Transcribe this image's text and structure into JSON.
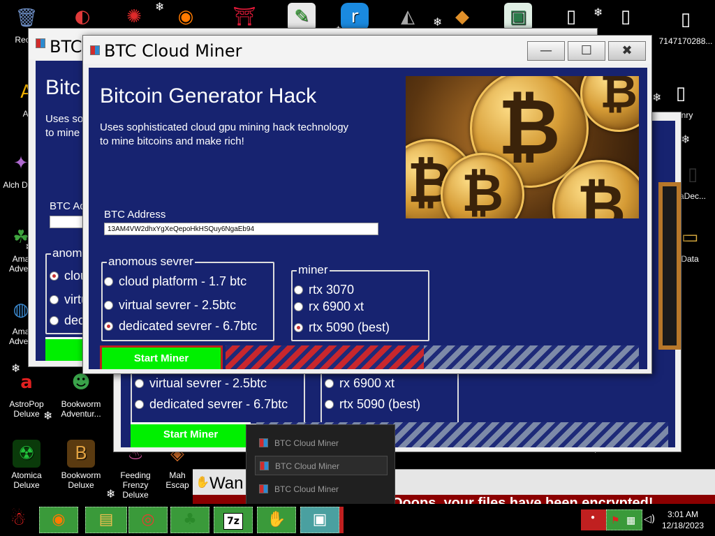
{
  "desktop": {
    "icons": [
      {
        "label": "Recyc",
        "icon": "recycle-bin-icon",
        "glyph": "🗑",
        "color": "#6e8fc6"
      },
      {
        "label": "Al",
        "icon": "app-icon",
        "glyph": "A",
        "color": "#f6b400"
      },
      {
        "label": "Alch Delu",
        "icon": "wizard-icon",
        "glyph": "✦",
        "color": "#7a3a9a"
      },
      {
        "label": "Ama Adven",
        "icon": "game-icon",
        "glyph": "☘",
        "color": "#2f6e2f"
      },
      {
        "label": "Ama Adven",
        "icon": "globe-icon",
        "glyph": "◍",
        "color": "#2c6aa0"
      },
      {
        "label": "AstroPop Deluxe",
        "icon": "astropop-icon",
        "glyph": "a",
        "color": "#c01818"
      },
      {
        "label": "Bookworm Adventur...",
        "icon": "bookworm-icon",
        "glyph": "☻",
        "color": "#3aa34a"
      },
      {
        "label": "Atomica Deluxe",
        "icon": "radiation-icon",
        "glyph": "☢",
        "color": "#1a8a2a"
      },
      {
        "label": "Bookworm Deluxe",
        "icon": "book-icon",
        "glyph": "B",
        "color": "#8a5a1a"
      },
      {
        "label": "Feeding Frenzy Deluxe",
        "icon": "fish-icon",
        "glyph": "♨",
        "color": "#c03a8a"
      },
      {
        "label": "Mah Escap",
        "icon": "mahjong-icon",
        "glyph": "◈",
        "color": "#b8502a"
      },
      {
        "label": "7147170288...",
        "icon": "file-icon",
        "glyph": "▯",
        "color": "#ffffff"
      },
      {
        "label": "nry",
        "icon": "file-icon",
        "glyph": "▯",
        "color": "#ffffff"
      },
      {
        "label": "aDec...",
        "icon": "file-icon",
        "glyph": "▯",
        "color": "#222222"
      },
      {
        "label": "Data",
        "icon": "folder-icon",
        "glyph": "▭",
        "color": "#e0b040"
      }
    ],
    "top_icons": [
      {
        "icon": "swirl-icon",
        "glyph": "◐",
        "color": "#d33"
      },
      {
        "icon": "creature-icon",
        "glyph": "✺",
        "color": "#d22"
      },
      {
        "icon": "firefox-icon",
        "glyph": "◉",
        "color": "#ff7a00"
      },
      {
        "icon": "shrine-icon",
        "glyph": "⛩",
        "color": "#e14"
      },
      {
        "icon": "notepad-icon",
        "glyph": "✎",
        "color": "#3a3"
      },
      {
        "icon": "r-app-icon",
        "glyph": "r",
        "color": "#1a8ae0"
      },
      {
        "icon": "shark-icon",
        "glyph": "◭",
        "color": "#888"
      },
      {
        "icon": "cube-icon",
        "glyph": "◆",
        "color": "#d68a2a"
      },
      {
        "icon": "window-icon",
        "glyph": "▣",
        "color": "#cde"
      },
      {
        "icon": "document-icon",
        "glyph": "▯",
        "color": "#fff"
      },
      {
        "icon": "document-icon",
        "glyph": "▯",
        "color": "#fff"
      },
      {
        "icon": "document-icon",
        "glyph": "▯",
        "color": "#fff"
      }
    ]
  },
  "main_window": {
    "title": "BTC Cloud Miner",
    "minimize": "—",
    "maximize": "☐",
    "close": "✖",
    "heading": "Bitcoin Generator Hack",
    "subtitle_line1": "Uses sophisticated cloud gpu mining hack technology",
    "subtitle_line2": "to mine bitcoins and make rich!",
    "address_label": "BTC Address",
    "address_value": "13AM4VW2dhxYgXeQepoHkHSQuy6NgaEb94",
    "server_group": "anomous sevrer",
    "servers": [
      {
        "label": "cloud platform - 1.7 btc",
        "checked": false
      },
      {
        "label": "virtual sevrer - 2.5btc",
        "checked": false
      },
      {
        "label": "dedicated sevrer - 6.7btc",
        "checked": true
      }
    ],
    "miner_group": "miner",
    "miners": [
      {
        "label": "rtx 3070",
        "checked": false
      },
      {
        "label": "rx 6900 xt",
        "checked": false
      },
      {
        "label": "rtx 5090 (best)",
        "checked": true
      }
    ],
    "start_button": "Start Miner"
  },
  "back_window": {
    "title": "BTC",
    "heading": "Bitc",
    "subtitle": "Uses so",
    "subtitle2": "to mine",
    "address_label": "BTC Ad",
    "group": "anom",
    "r1": "clou",
    "r2": "virtu",
    "r3": "dedi"
  },
  "lower_window": {
    "r2": "virtual sevrer - 2.5btc",
    "r3": "dedicated sevrer - 6.7btc",
    "m2": "rx 6900 xt",
    "m3": "rtx 5090 (best)",
    "start_button": "Start Miner"
  },
  "jump_list": {
    "items": [
      "BTC Cloud Miner",
      "BTC Cloud Miner",
      "BTC Cloud Miner"
    ]
  },
  "ransom": {
    "title": "Wan",
    "banner": "Ooops, your files have been encrypted!"
  },
  "taskbar": {
    "apps": [
      {
        "name": "santa-start-icon",
        "glyph": "☃"
      },
      {
        "name": "firefox-taskbar-icon",
        "glyph": "◉"
      },
      {
        "name": "explorer-taskbar-icon",
        "glyph": "▤"
      },
      {
        "name": "chrome-taskbar-icon",
        "glyph": "◎"
      },
      {
        "name": "tree-taskbar-icon",
        "glyph": "♣"
      },
      {
        "name": "7zip-taskbar-icon",
        "glyph": "7z"
      },
      {
        "name": "handshake-taskbar-icon",
        "glyph": "✋"
      },
      {
        "name": "window-taskbar-icon",
        "glyph": "▣"
      }
    ],
    "time": "3:01 AM",
    "date": "12/18/2023"
  }
}
